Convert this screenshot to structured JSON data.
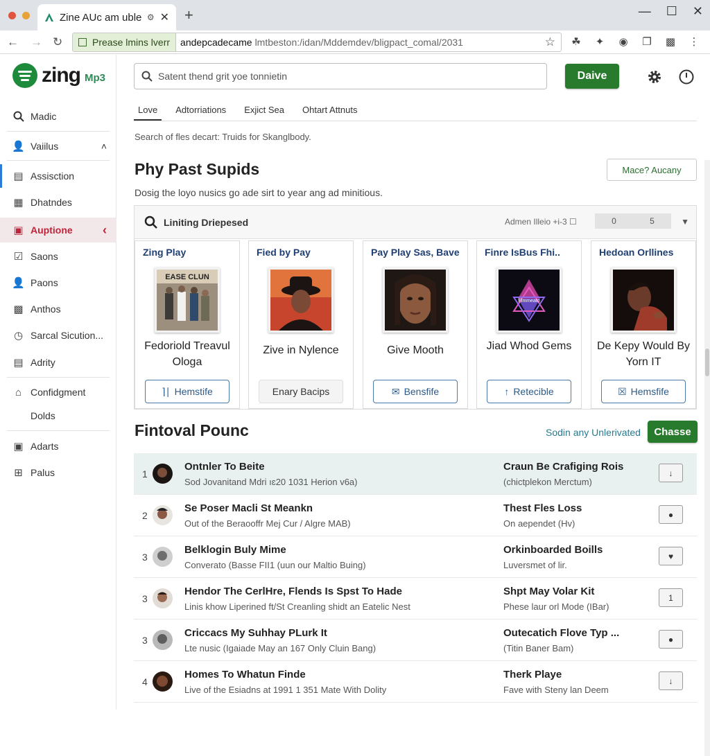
{
  "browser": {
    "tab_title": "Zine AUc am uble",
    "new_tab_symbol": "+",
    "secure_label": "Prease lmins lverr",
    "url_host": "andepcadecame",
    "url_path": "lmtbeston:/idan/Mddemdev/bligpact_comal/2031"
  },
  "brand": {
    "name": "zing",
    "suffix": "Mp3",
    "accent_color": "#1e8a3c",
    "active_color": "#c0243a"
  },
  "sidebar": {
    "items": [
      {
        "label": "Madic",
        "icon": "search-icon"
      },
      {
        "label": "Vaiilus",
        "icon": "user-icon"
      },
      {
        "label": "Assisction",
        "icon": "album-icon"
      },
      {
        "label": "Dhatndes",
        "icon": "stack-icon"
      },
      {
        "label": "Auptione",
        "icon": "record-icon"
      },
      {
        "label": "Saons",
        "icon": "check-icon"
      },
      {
        "label": "Paons",
        "icon": "person-icon"
      },
      {
        "label": "Anthos",
        "icon": "bars-icon"
      },
      {
        "label": "Sarcal Sicution...",
        "icon": "clock-icon"
      },
      {
        "label": "Adrity",
        "icon": "list-icon"
      },
      {
        "label": "Confidgment",
        "icon": "home-icon"
      },
      {
        "label": "Dolds",
        "icon": ""
      },
      {
        "label": "Adarts",
        "icon": "frame-icon"
      },
      {
        "label": "Palus",
        "icon": "plus-icon"
      }
    ]
  },
  "header": {
    "search_placeholder": "Satent thend grit yoe tonnietin",
    "primary_button": "Daive"
  },
  "tabs": [
    "Love",
    "Adtorriations",
    "Exjict Sea",
    "Ohtart Attnuts"
  ],
  "helper_text": "Search of fles decart: Truids for Skanglbody.",
  "section1": {
    "title": "Phy Past Supids",
    "action": "Mace? Aucany",
    "description": "Dosig the loyo nusics go ade sirt to year ang ad minitious."
  },
  "panel": {
    "title": "Liniting Driepesed",
    "meta": "Admen Illeio +i-3 ☐",
    "range_from": "0",
    "range_to": "5"
  },
  "cards": [
    {
      "header": "Zing Play",
      "cover_text": "EASE CLUN",
      "title": "Fedoriold Treavul Ologa",
      "button": "Hemstife",
      "button_icon": "⌉∣"
    },
    {
      "header": "Fied by Pay",
      "cover_text": "",
      "title": "Zive in Nylence",
      "button": "Enary Bacips",
      "button_icon": ""
    },
    {
      "header": "Pay Play Sas, Bave",
      "cover_text": "",
      "title": "Give Mooth",
      "button": "Bensfife",
      "button_icon": "✉"
    },
    {
      "header": "Finre IsBus Fhi..",
      "cover_text": "Elmmeato",
      "title": "Jiad Whod Gems",
      "button": "Retecible",
      "button_icon": "↑"
    },
    {
      "header": "Hedoan Orllines",
      "cover_text": "",
      "title": "De Kepy Would By Yorn IT",
      "button": "Hemsfife",
      "button_icon": "☒"
    }
  ],
  "section2": {
    "title": "Fintoval Pounc",
    "link": "Sodin any Unlerivated",
    "button": "Chasse"
  },
  "tracks": [
    {
      "num": "1",
      "title": "Ontnler To Beite",
      "sub": "Sod Jovanitand Mdri ıɛ20 1031 Herion v6a)",
      "artist": "Craun Be Crafiging Rois",
      "artist_sub": "(chictplekon Merctum)",
      "action_icon": "↓"
    },
    {
      "num": "2",
      "title": "Se Poser Macli St Meankn",
      "sub": "Out of the Beraooffr Mej Cur / Algre MAB)",
      "artist": "Thest Fles Loss",
      "artist_sub": "On aependet (Hv)",
      "action_icon": "●"
    },
    {
      "num": "3",
      "title": "Belklogin Buly Mime",
      "sub": "Converato (Basse FII1 (uun our Maltio Buing)",
      "artist": "Orkinboarded Boills",
      "artist_sub": "Luversmet of lir.",
      "action_icon": "♥"
    },
    {
      "num": "3",
      "title": "Hendor The CerlHre, Flends Is Spst To Hade",
      "sub": "Linis khow Liperined ft/St Creanling shidt an Eatelic Nest",
      "artist": "Shpt May Volar Kit",
      "artist_sub": "Phese laur orl Mode (IBar)",
      "action_icon": "1"
    },
    {
      "num": "3",
      "title": "Criccacs My Suhhay PLurk It",
      "sub": "Lte nusic (Igaiade May an 167 Only Cluin Bang)",
      "artist": "Outecatich Flove Typ ...",
      "artist_sub": "(Titin Baner Bam)",
      "action_icon": "●"
    },
    {
      "num": "4",
      "title": "Homes To Whatun Finde",
      "sub": "Live of the Esiadns at 1991 1 351 Mate With Dolity",
      "artist": "Therk Playe",
      "artist_sub": "Fave with Steny lan Deem",
      "action_icon": "↓"
    }
  ]
}
